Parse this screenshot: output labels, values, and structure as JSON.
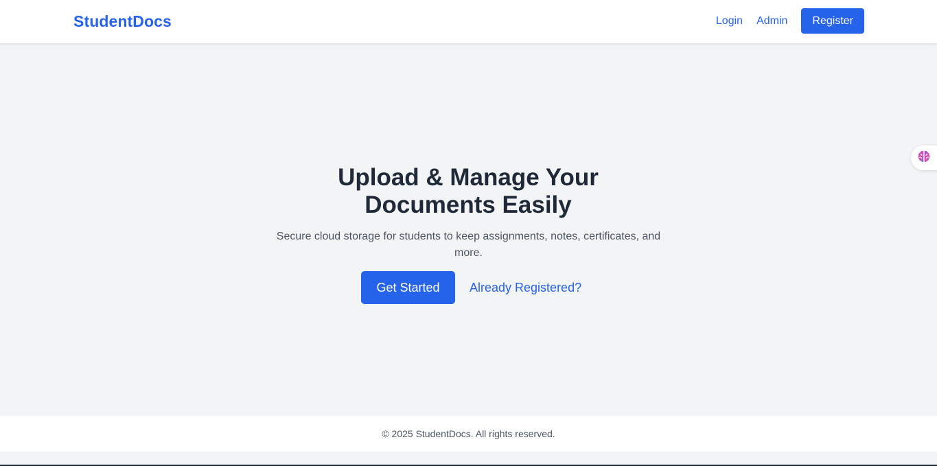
{
  "header": {
    "brand": "StudentDocs",
    "nav": {
      "login": "Login",
      "admin": "Admin",
      "register": "Register"
    }
  },
  "hero": {
    "title_line1": "Upload & Manage Your",
    "title_line2": "Documents Easily",
    "subtitle_line1": "Secure cloud storage for students to keep assignments, notes, certificates, and",
    "subtitle_line2": "more.",
    "primary_cta": "Get Started",
    "secondary_cta": "Already Registered?"
  },
  "floating_widget": {
    "icon": "brain-icon"
  },
  "footer": {
    "text": "© 2025 StudentDocs. All rights reserved."
  },
  "colors": {
    "accent": "#2563eb",
    "heading": "#1f2937",
    "body_text": "#4b5563",
    "page_bg": "#f3f4f6"
  }
}
